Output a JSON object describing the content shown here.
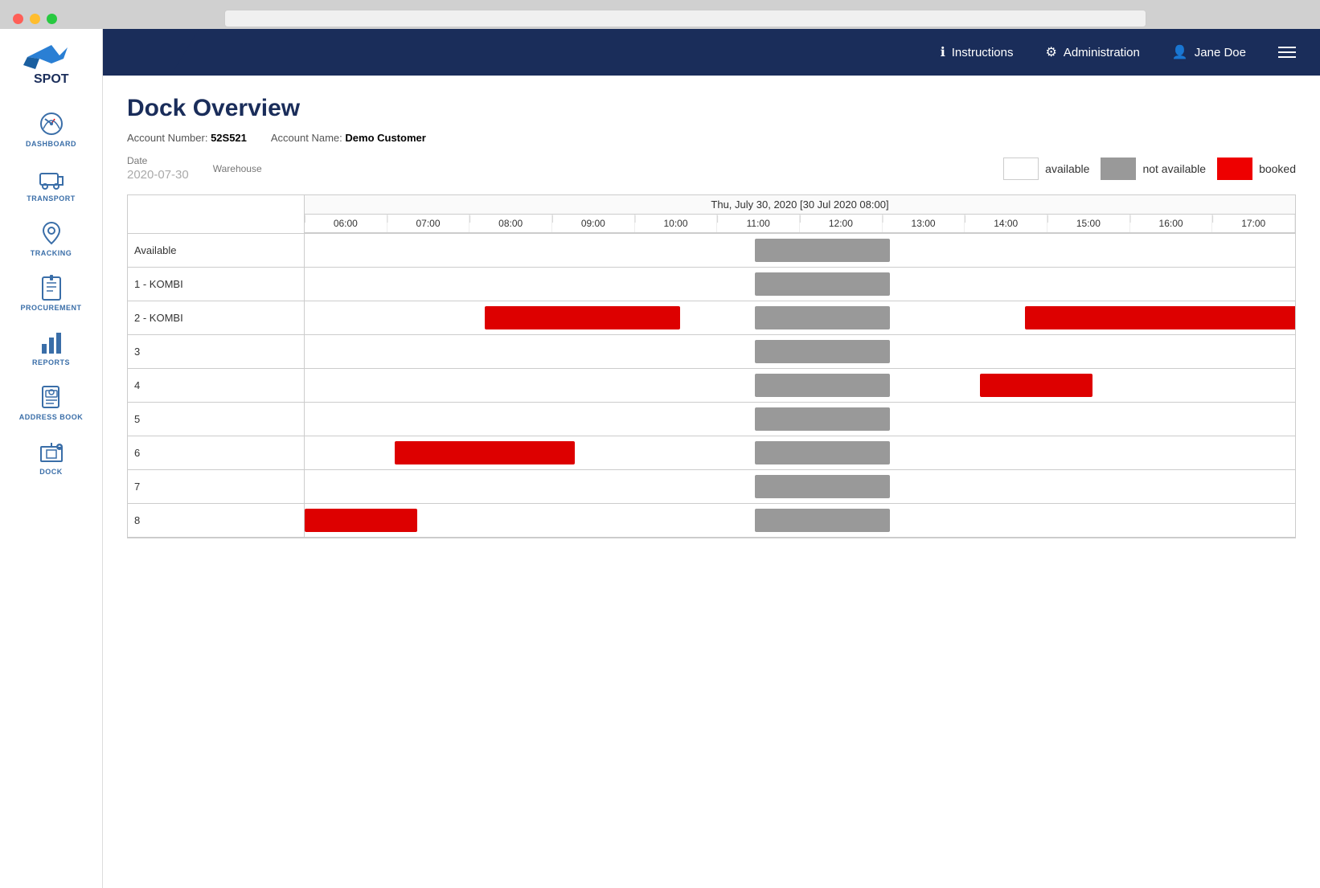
{
  "window": {
    "address_bar_placeholder": ""
  },
  "sidebar": {
    "logo_text": "SPOT",
    "items": [
      {
        "id": "dashboard",
        "label": "Dashboard",
        "icon": "⏱"
      },
      {
        "id": "transport",
        "label": "Transport",
        "icon": "🚚"
      },
      {
        "id": "tracking",
        "label": "Tracking",
        "icon": "📍"
      },
      {
        "id": "procurement",
        "label": "Procurement",
        "icon": "📋"
      },
      {
        "id": "reports",
        "label": "Reports",
        "icon": "📊"
      },
      {
        "id": "address-book",
        "label": "Address Book",
        "icon": "📓"
      },
      {
        "id": "dock",
        "label": "Dock",
        "icon": "🏭"
      }
    ]
  },
  "topnav": {
    "instructions_label": "Instructions",
    "administration_label": "Administration",
    "user_label": "Jane Doe"
  },
  "page": {
    "title": "Dock Overview",
    "account_number_label": "Account Number:",
    "account_number_value": "52S521",
    "account_name_label": "Account Name:",
    "account_name_value": "Demo Customer",
    "date_label": "Date",
    "date_value": "2020-07-30",
    "warehouse_label": "Warehouse"
  },
  "legend": {
    "available_label": "available",
    "not_available_label": "not available",
    "booked_label": "booked"
  },
  "gantt": {
    "date_header": "Thu, July 30, 2020 [30 Jul 2020 08:00]",
    "hours": [
      "06:00",
      "07:00",
      "08:00",
      "09:00",
      "10:00",
      "11:00",
      "12:00",
      "13:00",
      "14:00",
      "15:00",
      "16:00",
      "17:00"
    ],
    "rows": [
      {
        "label": "Available",
        "blocks": [
          {
            "type": "gray",
            "start_min": 300,
            "duration_min": 90
          }
        ]
      },
      {
        "label": "1 - KOMBI",
        "blocks": [
          {
            "type": "gray",
            "start_min": 300,
            "duration_min": 90
          }
        ]
      },
      {
        "label": "2 - KOMBI",
        "blocks": [
          {
            "type": "red",
            "start_min": 120,
            "duration_min": 130
          },
          {
            "type": "gray",
            "start_min": 300,
            "duration_min": 90
          },
          {
            "type": "red",
            "start_min": 480,
            "duration_min": 190
          }
        ]
      },
      {
        "label": "3",
        "blocks": [
          {
            "type": "gray",
            "start_min": 300,
            "duration_min": 90
          }
        ]
      },
      {
        "label": "4",
        "blocks": [
          {
            "type": "gray",
            "start_min": 300,
            "duration_min": 90
          },
          {
            "type": "red",
            "start_min": 450,
            "duration_min": 75
          }
        ]
      },
      {
        "label": "5",
        "blocks": [
          {
            "type": "gray",
            "start_min": 300,
            "duration_min": 90
          }
        ]
      },
      {
        "label": "6",
        "blocks": [
          {
            "type": "red",
            "start_min": 60,
            "duration_min": 120
          },
          {
            "type": "gray",
            "start_min": 300,
            "duration_min": 90
          }
        ]
      },
      {
        "label": "7",
        "blocks": [
          {
            "type": "gray",
            "start_min": 300,
            "duration_min": 90
          }
        ]
      },
      {
        "label": "8",
        "blocks": [
          {
            "type": "red",
            "start_min": 0,
            "duration_min": 75
          },
          {
            "type": "gray",
            "start_min": 300,
            "duration_min": 90
          }
        ]
      }
    ]
  }
}
